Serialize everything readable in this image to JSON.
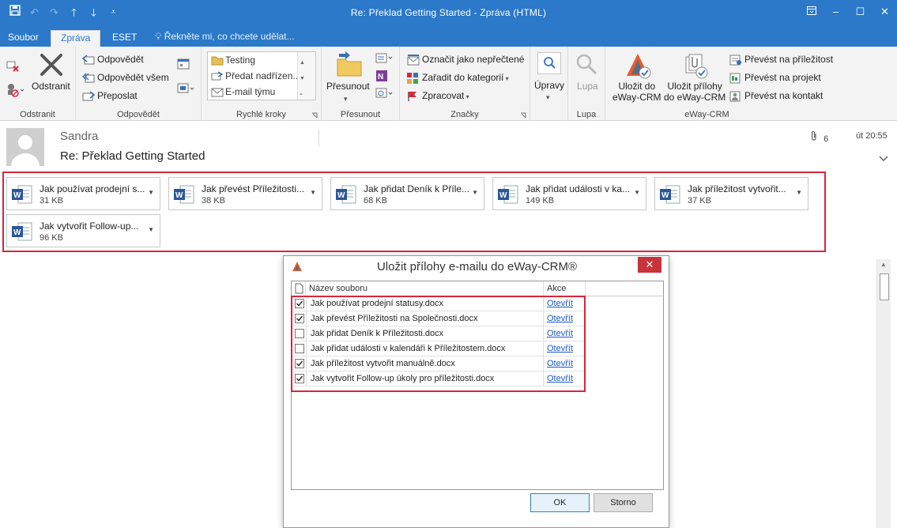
{
  "window": {
    "title": "Re: Překlad Getting Started - Zpráva (HTML)"
  },
  "tabs": [
    {
      "label": "Soubor"
    },
    {
      "label": "Zpráva"
    },
    {
      "label": "ESET"
    }
  ],
  "tell_me": "Řekněte mi, co chcete udělat...",
  "ribbon": {
    "delete_group": {
      "label": "Odstranit",
      "delete_button": "Odstranit"
    },
    "respond_group": {
      "label": "Odpovědět",
      "reply": "Odpovědět",
      "reply_all": "Odpovědět všem",
      "forward": "Přeposlat"
    },
    "quick_steps": {
      "label": "Rychlé kroky",
      "items": [
        "Testing",
        "Předat nadřízen...",
        "E-mail týmu"
      ]
    },
    "move_group": {
      "label": "Přesunout",
      "move_button": "Přesunout"
    },
    "tags_group": {
      "label": "Značky",
      "mark_unread": "Označit jako nepřečtené",
      "categorize": "Zařadit do kategorií",
      "follow_up": "Zpracovat"
    },
    "edit_group": {
      "label": "Úpravy"
    },
    "zoom_group": {
      "label": "Lupa",
      "zoom_button": "Lupa"
    },
    "eway_group": {
      "label": "eWay-CRM",
      "save_to": "Uložit do\neWay-CRM",
      "save_to_l1": "Uložit do",
      "save_to_l2": "eWay-CRM",
      "save_attachments_l1": "Uložit přílohy",
      "save_attachments_l2": "do eWay-CRM",
      "convert_opportunity": "Převést na příležitost",
      "convert_project": "Převést na projekt",
      "convert_contact": "Převést na kontakt"
    }
  },
  "message": {
    "sender": "Sandra",
    "subject": "Re: Překlad Getting Started",
    "attachment_count": "6",
    "time": "út 20:55"
  },
  "attachments": [
    {
      "name": "Jak používat prodejní s...",
      "size": "31 KB"
    },
    {
      "name": "Jak převést Příležitosti...",
      "size": "38 KB"
    },
    {
      "name": "Jak přidat Deník k Příle...",
      "size": "68 KB"
    },
    {
      "name": "Jak přidat události v ka...",
      "size": "149 KB"
    },
    {
      "name": "Jak příležitost vytvořit...",
      "size": "37 KB"
    },
    {
      "name": "Jak vytvořit Follow-up...",
      "size": "96 KB"
    }
  ],
  "dialog": {
    "title": "Uložit přílohy e-mailu do eWay-CRM®",
    "col_name": "Název souboru",
    "col_action": "Akce",
    "rows": [
      {
        "checked": true,
        "file": "Jak používat prodejní statusy.docx",
        "action": "Otevřít"
      },
      {
        "checked": true,
        "file": "Jak převést Příležitosti na Společnosti.docx",
        "action": "Otevřít"
      },
      {
        "checked": false,
        "file": "Jak přidat Deník k Příležitosti.docx",
        "action": "Otevřít"
      },
      {
        "checked": false,
        "file": "Jak přidat události v kalendáři k Příležitostem.docx",
        "action": "Otevřít"
      },
      {
        "checked": true,
        "file": "Jak příležitost vytvořit manuálně.docx",
        "action": "Otevřít"
      },
      {
        "checked": true,
        "file": "Jak vytvořit Follow-up úkoly pro příležitosti.docx",
        "action": "Otevřít"
      }
    ],
    "ok": "OK",
    "cancel": "Storno"
  },
  "colors": {
    "titlebar": "#2b79c8",
    "highlight": "#d7263d",
    "link": "#1b5ccc"
  }
}
